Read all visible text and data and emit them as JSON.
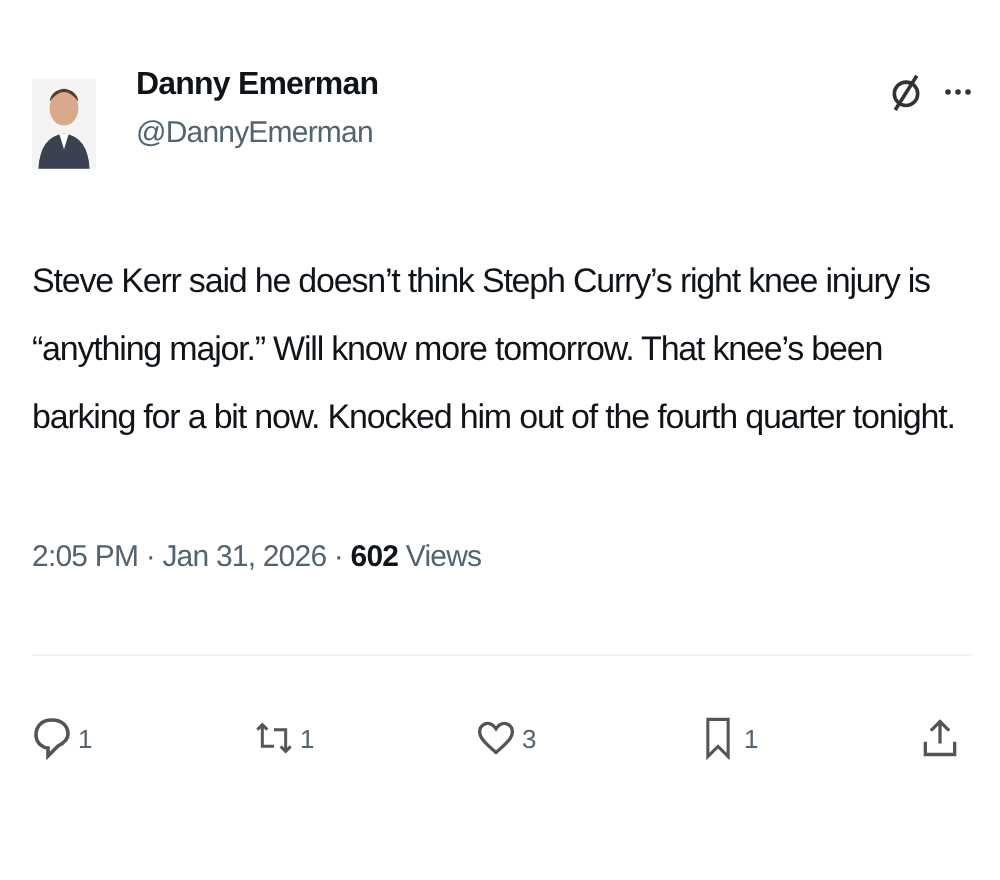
{
  "author": {
    "name": "Danny Emerman",
    "handle": "@DannyEmerman"
  },
  "body": "Steve Kerr said he doesn’t think Steph Curry’s right knee injury is “anything major.” Will know more tomorrow. That knee’s been barking for a bit now. Knocked him out of the fourth quarter tonight.",
  "meta": "2:05 PM · Jan 31, 2026 · **602** Views",
  "actions": [
    {
      "kind": "reply",
      "count": "1"
    },
    {
      "kind": "repost",
      "count": "1"
    },
    {
      "kind": "like",
      "count": "3"
    },
    {
      "kind": "bookmark",
      "count": "1"
    },
    {
      "kind": "share"
    }
  ]
}
